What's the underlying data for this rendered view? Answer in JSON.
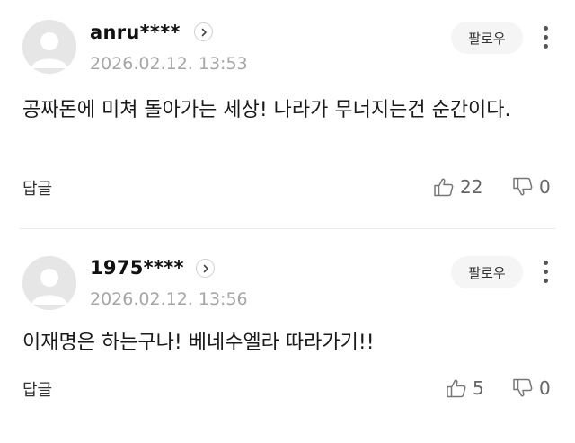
{
  "comments": [
    {
      "username": "anru****",
      "timestamp": "2026.02.12. 13:53",
      "follow_label": "팔로우",
      "text": "공짜돈에 미쳐 돌아가는 세상! 나라가 무너지는건 순간이다.",
      "reply_label": "답글",
      "likes": "22",
      "dislikes": "0"
    },
    {
      "username": "1975****",
      "timestamp": "2026.02.12. 13:56",
      "follow_label": "팔로우",
      "text": "이재명은 하는구나! 베네수엘라 따라가기!!",
      "reply_label": "답글",
      "likes": "5",
      "dislikes": "0"
    }
  ],
  "icons": {
    "avatar": "default-avatar-icon",
    "profile": "chevron-right-icon",
    "more": "vertical-dots-icon",
    "like": "thumbs-up-icon",
    "dislike": "thumbs-down-icon"
  },
  "colors": {
    "timestamp": "#a6a6a6",
    "follow_bg": "#f5f5f5",
    "avatar_bg": "#e6e6e6",
    "divider": "#ebebeb"
  }
}
